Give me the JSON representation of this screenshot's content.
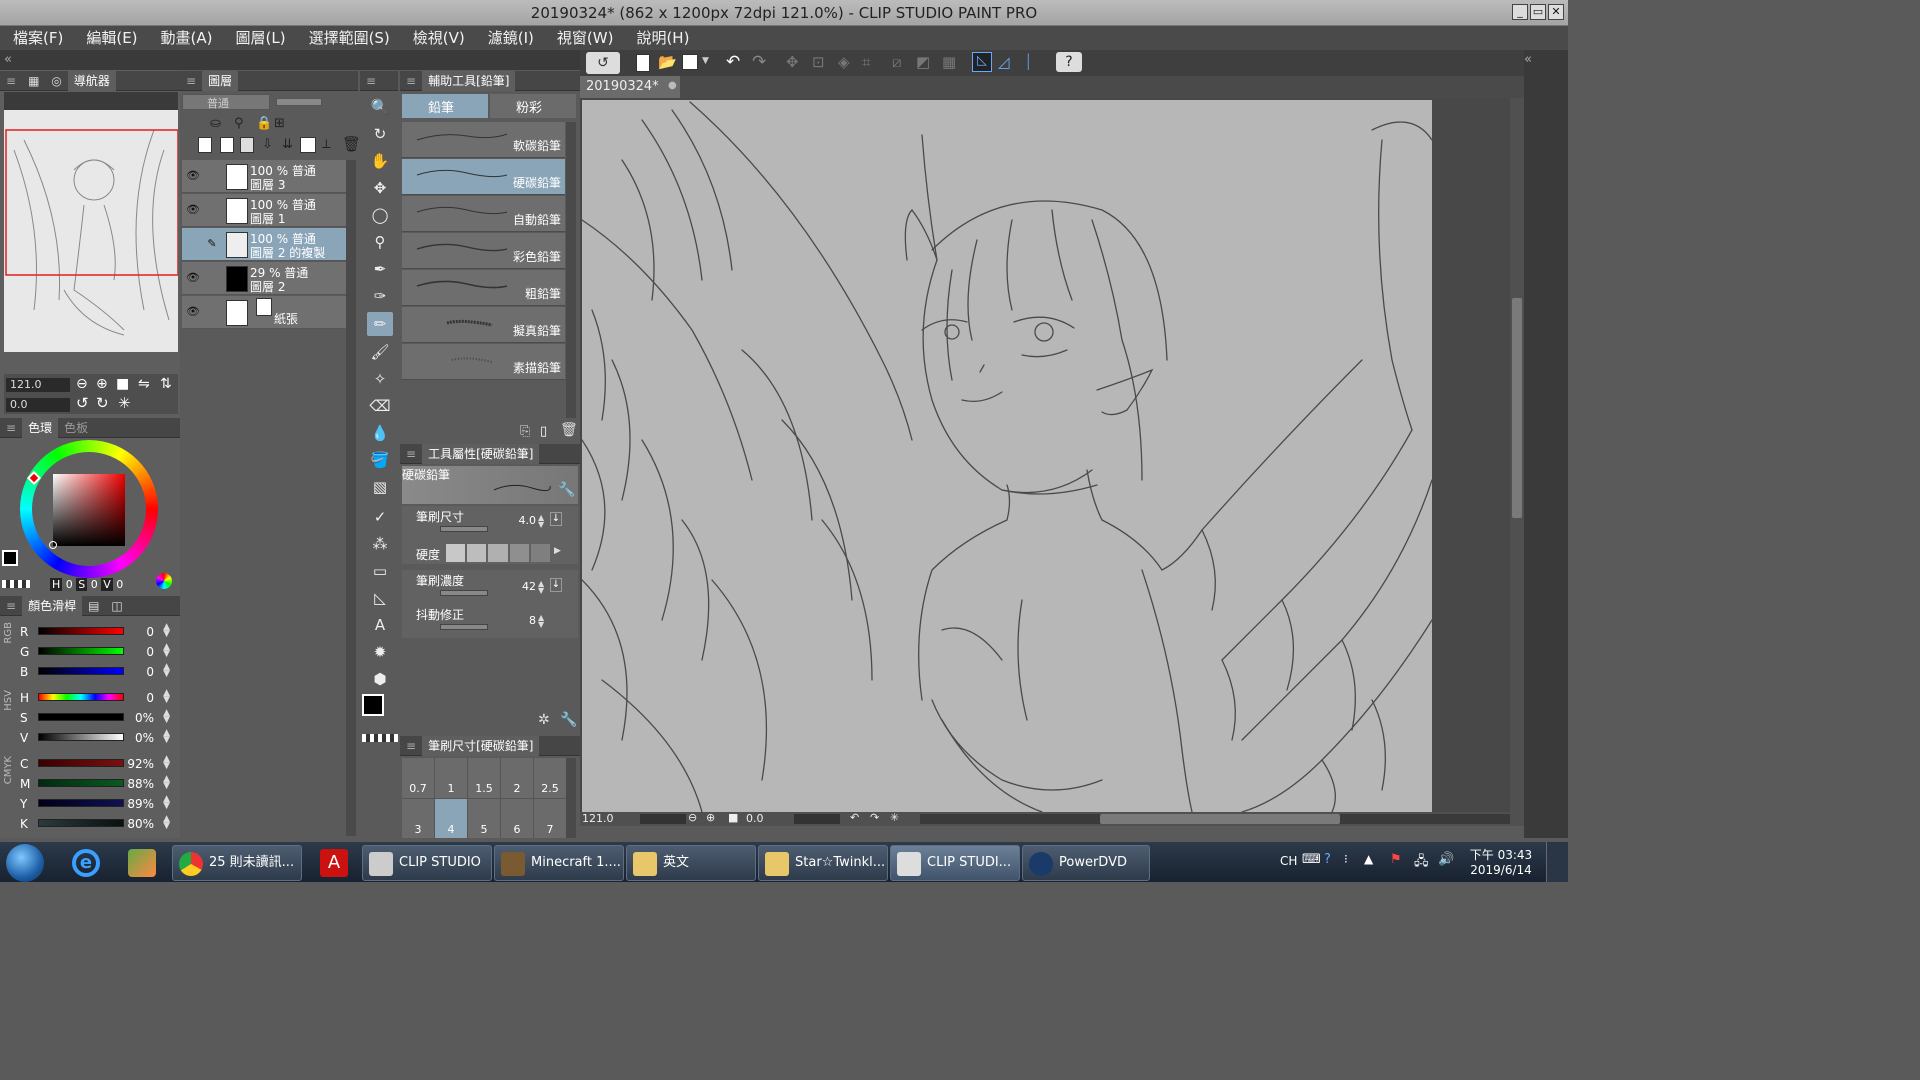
{
  "window": {
    "title": "20190324* (862 x 1200px 72dpi 121.0%)  - CLIP STUDIO PAINT PRO"
  },
  "menu": [
    "檔案(F)",
    "編輯(E)",
    "動畫(A)",
    "圖層(L)",
    "選擇範圍(S)",
    "檢視(V)",
    "濾鏡(I)",
    "視窗(W)",
    "說明(H)"
  ],
  "navigator": {
    "tab": "導航器",
    "zoom": "121.0",
    "rotate": "0.0"
  },
  "layers": {
    "tab": "圖層",
    "blend_mode": "普通",
    "items": [
      {
        "line1": "100 % 普通",
        "line2": "圖層 3",
        "visible": true,
        "selected": false
      },
      {
        "line1": "100 % 普通",
        "line2": "圖層 1",
        "visible": true,
        "selected": false
      },
      {
        "line1": "100 % 普通",
        "line2": "圖層 2 的複製",
        "visible": false,
        "selected": true
      },
      {
        "line1": "29 % 普通",
        "line2": "圖層 2",
        "visible": true,
        "selected": false
      },
      {
        "line1": "",
        "line2": "紙張",
        "visible": true,
        "selected": false
      }
    ]
  },
  "color_wheel": {
    "tab1": "色環",
    "tab2": "色板",
    "h_label": "H",
    "h_val": "0",
    "s_label": "S",
    "s_val": "0",
    "v_label": "V",
    "v_val": "0"
  },
  "color_slider": {
    "tab": "顏色滑桿",
    "rgb": [
      {
        "label": "R",
        "value": "0"
      },
      {
        "label": "G",
        "value": "0"
      },
      {
        "label": "B",
        "value": "0"
      }
    ],
    "hsv": [
      {
        "label": "H",
        "value": "0"
      },
      {
        "label": "S",
        "value": "0%"
      },
      {
        "label": "V",
        "value": "0%"
      }
    ],
    "cmyk": [
      {
        "label": "C",
        "value": "92%"
      },
      {
        "label": "M",
        "value": "88%"
      },
      {
        "label": "Y",
        "value": "89%"
      },
      {
        "label": "K",
        "value": "80%"
      }
    ],
    "group_rgb": "RGB",
    "group_hsv": "HSV",
    "group_cmyk": "CMYK"
  },
  "sub_tool": {
    "header": "輔助工具[鉛筆]",
    "tab_pencil": "鉛筆",
    "tab_pastel": "粉彩",
    "brushes": [
      "軟碳鉛筆",
      "硬碳鉛筆",
      "自動鉛筆",
      "彩色鉛筆",
      "粗鉛筆",
      "擬真鉛筆",
      "素描鉛筆"
    ],
    "selected_index": 1
  },
  "tool_property": {
    "header": "工具屬性[硬碳鉛筆]",
    "preview_name": "硬碳鉛筆",
    "brush_size_label": "筆刷尺寸",
    "brush_size_val": "4.0",
    "hardness_label": "硬度",
    "density_label": "筆刷濃度",
    "density_val": "42",
    "stabilization_label": "抖動修正",
    "stabilization_val": "8"
  },
  "brush_size": {
    "header": "筆刷尺寸[硬碳鉛筆]",
    "row1": [
      "0.7",
      "1",
      "1.5",
      "2",
      "2.5"
    ],
    "row2": [
      "3",
      "4",
      "5",
      "6",
      "7"
    ],
    "selected": "4"
  },
  "canvas": {
    "tab": "20190324*",
    "zoom": "121.0",
    "angle": "0.0"
  },
  "taskbar": {
    "items": [
      "25 則未讀訊...",
      "CLIP STUDIO",
      "Minecraft 1....",
      "英文",
      "Star☆Twinkl...",
      "CLIP STUDI...",
      "PowerDVD"
    ],
    "lang": "CH",
    "time": "下午 03:43",
    "date": "2019/6/14"
  }
}
